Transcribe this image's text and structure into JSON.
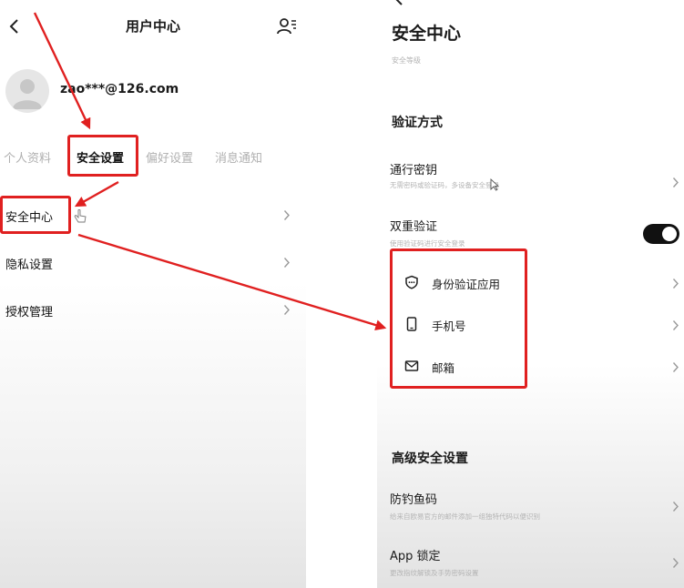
{
  "left_screen": {
    "nav": {
      "back_icon": "chevron-left-icon",
      "title": "用户中心",
      "contacts_icon": "user-contacts-icon"
    },
    "profile": {
      "avatar_icon": "default-avatar-icon",
      "email": "zao***@126.com"
    },
    "tabs": [
      {
        "label": "个人资料",
        "active": false
      },
      {
        "label": "安全设置",
        "active": true
      },
      {
        "label": "偏好设置",
        "active": false
      },
      {
        "label": "消息通知",
        "active": false
      }
    ],
    "menu": [
      {
        "label": "安全中心",
        "icon": "chevron-right-icon"
      },
      {
        "label": "隐私设置",
        "icon": "chevron-right-icon"
      },
      {
        "label": "授权管理",
        "icon": "chevron-right-icon"
      }
    ]
  },
  "right_screen": {
    "title": "安全中心",
    "subtitle": "安全等级",
    "verification_section": {
      "heading": "验证方式",
      "passkey": {
        "title": "通行密钥",
        "description": "无需密码或验证码，多设备安全登录"
      },
      "two_factor": {
        "title": "双重验证",
        "description": "使用验证码进行安全登录",
        "enabled": true
      },
      "methods": [
        {
          "label": "身份验证应用",
          "icon": "shield-icon"
        },
        {
          "label": "手机号",
          "icon": "phone-icon"
        },
        {
          "label": "邮箱",
          "icon": "mail-icon"
        }
      ]
    },
    "advanced_section": {
      "heading": "高级安全设置",
      "anti_phishing": {
        "title": "防钓鱼码",
        "description": "给来自欧易官方的邮件添加一组独特代码以便识别"
      },
      "app_lock": {
        "title": "App 锁定",
        "description": "更改指纹解锁及手势密码设置"
      }
    }
  },
  "colors": {
    "annotation_red": "#e02020",
    "toggle_on": "#111111",
    "muted_text": "#b4b4b4"
  }
}
